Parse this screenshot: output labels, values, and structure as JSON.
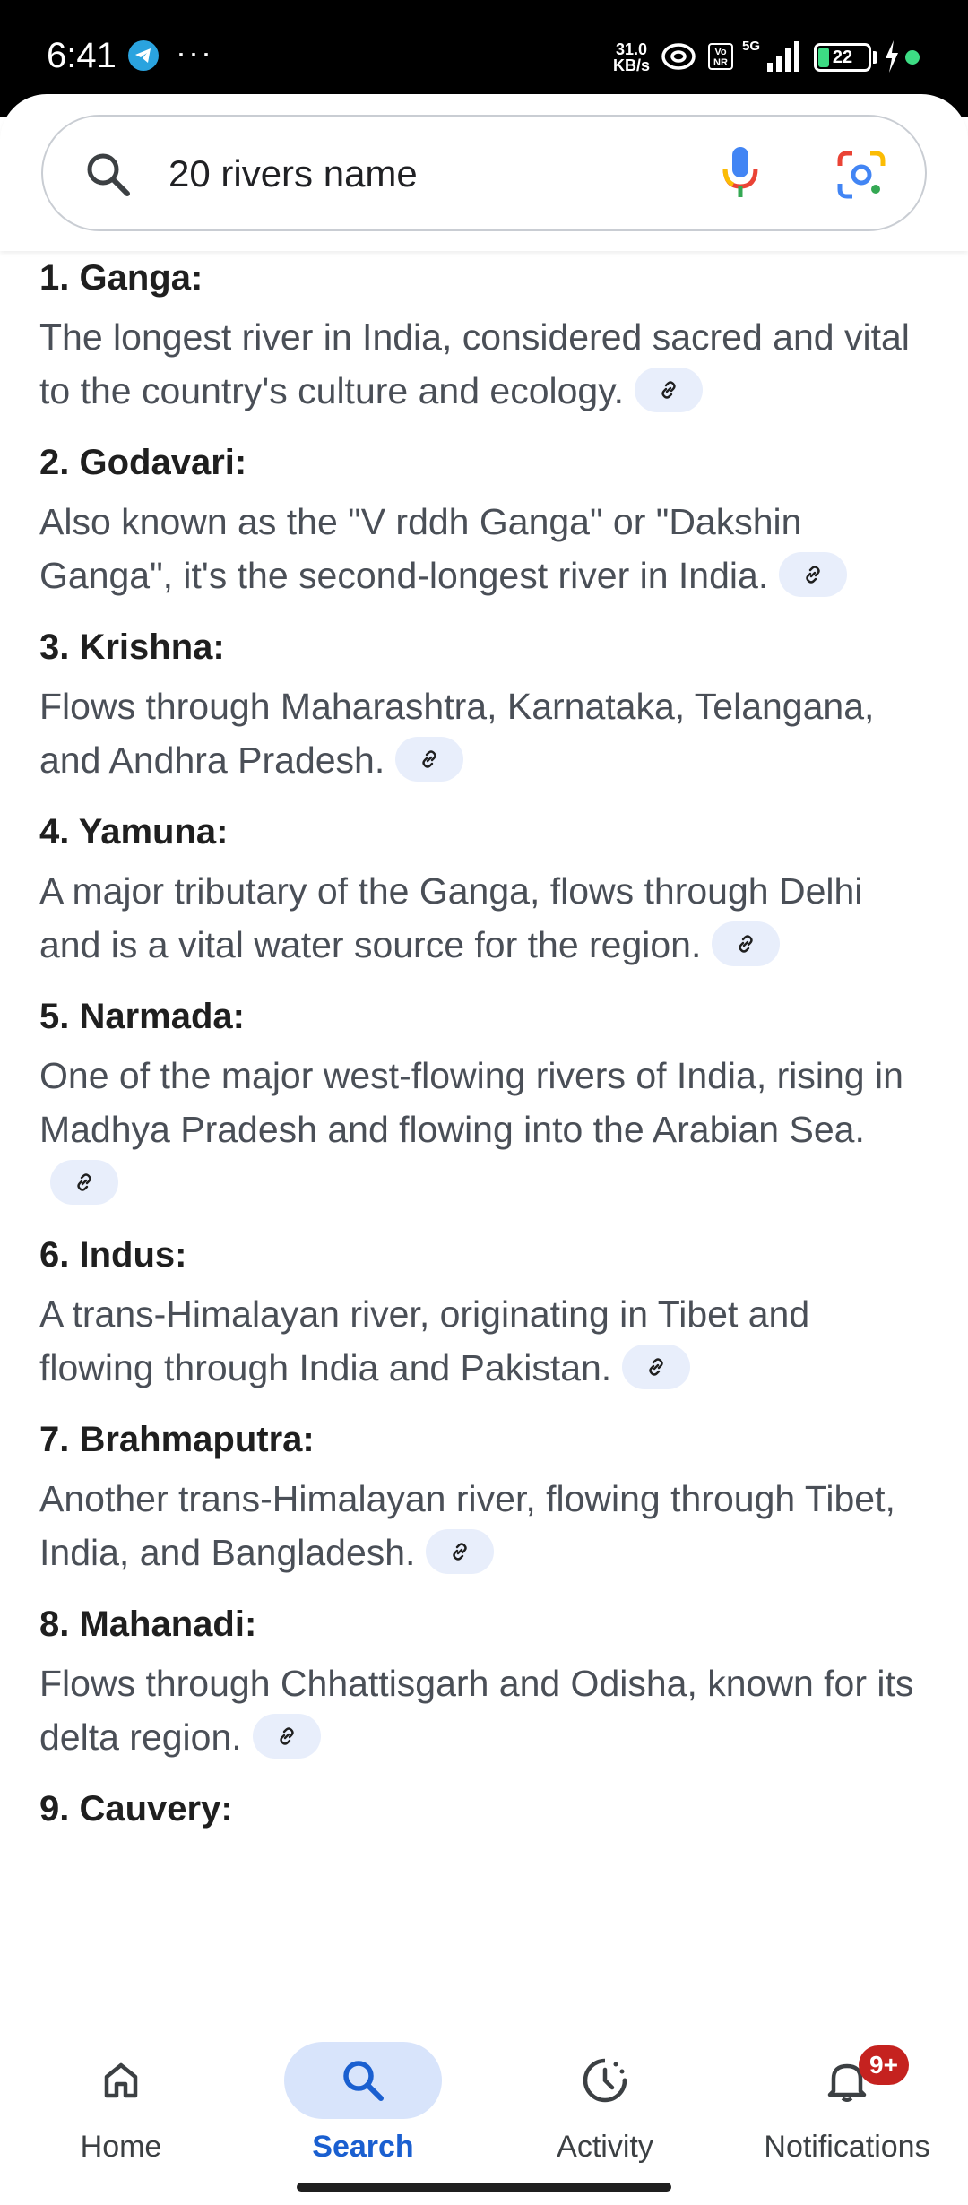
{
  "status_bar": {
    "time": "6:41",
    "more": "···",
    "net_speed_value": "31.0",
    "net_speed_unit": "KB/s",
    "volte": "Vo NR",
    "network": "5G",
    "battery_level": "22",
    "battery_fill_fraction": 0.22
  },
  "search": {
    "query": "20 rivers name"
  },
  "rivers": [
    {
      "title": "1. Ganga:",
      "desc": "The longest river in India, considered sacred and vital to the country's culture and ecology."
    },
    {
      "title": "2. Godavari:",
      "desc": "Also known as the \"V rddh Ganga\" or \"Dakshin Ganga\", it's the second-longest river in India."
    },
    {
      "title": "3. Krishna:",
      "desc": "Flows through Maharashtra, Karnataka, Telangana, and Andhra Pradesh."
    },
    {
      "title": "4. Yamuna:",
      "desc": "A major tributary of the Ganga, flows through Delhi and is a vital water source for the region."
    },
    {
      "title": "5. Narmada:",
      "desc": "One of the major west-flowing rivers of India, rising in Madhya Pradesh and flowing into the Arabian Sea."
    },
    {
      "title": "6. Indus:",
      "desc": "A trans-Himalayan river, originating in Tibet and flowing through India and Pakistan."
    },
    {
      "title": "7. Brahmaputra:",
      "desc": "Another trans-Himalayan river, flowing through Tibet, India, and Bangladesh."
    },
    {
      "title": "8. Mahanadi:",
      "desc": "Flows through Chhattisgarh and Odisha, known for its delta region."
    },
    {
      "title": "9. Cauvery:",
      "desc": ""
    }
  ],
  "bottom_nav": {
    "home": "Home",
    "search": "Search",
    "activity": "Activity",
    "notifications": "Notifications",
    "notifications_badge": "9+"
  },
  "colors": {
    "accent": "#1a5fd0",
    "active_pill": "#d8e4fb",
    "link_chip": "#e8eefb",
    "badge": "#c5221f"
  }
}
